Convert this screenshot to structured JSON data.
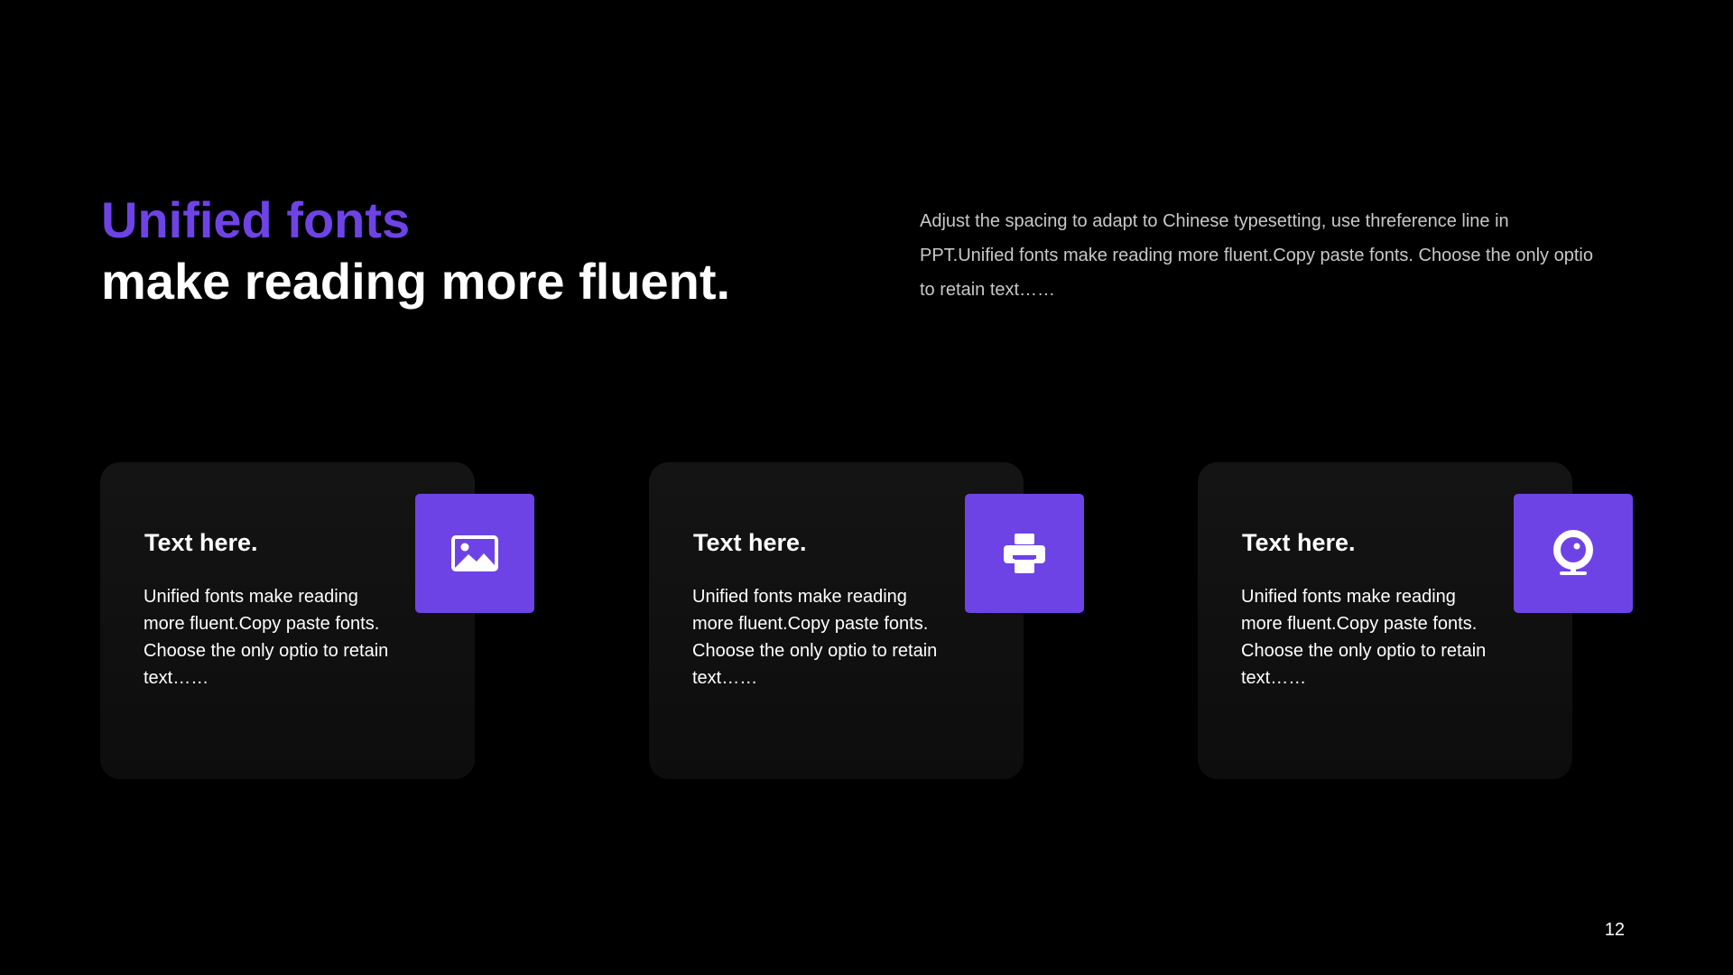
{
  "slide": {
    "title_accent": "Unified fonts",
    "title_main": "make reading more fluent.",
    "intro": "Adjust the spacing to adapt to Chinese typesetting, use threference line in PPT.Unified fonts make reading more fluent.Copy paste fonts. Choose the only optio to retain text……",
    "page_number": "12"
  },
  "cards": [
    {
      "title": "Text here.",
      "text": "Unified fonts make reading more fluent.Copy paste fonts. Choose the only optio to retain text……",
      "icon": "image-icon"
    },
    {
      "title": "Text here.",
      "text": "Unified fonts make reading more fluent.Copy paste fonts. Choose the only optio to retain text……",
      "icon": "printer-icon"
    },
    {
      "title": "Text here.",
      "text": "Unified fonts make reading more fluent.Copy paste fonts. Choose the only optio to retain text……",
      "icon": "webcam-icon"
    }
  ],
  "colors": {
    "accent": "#6e43e6",
    "background": "#000000",
    "card": "#111111",
    "body_text": "#c8c8c8"
  }
}
